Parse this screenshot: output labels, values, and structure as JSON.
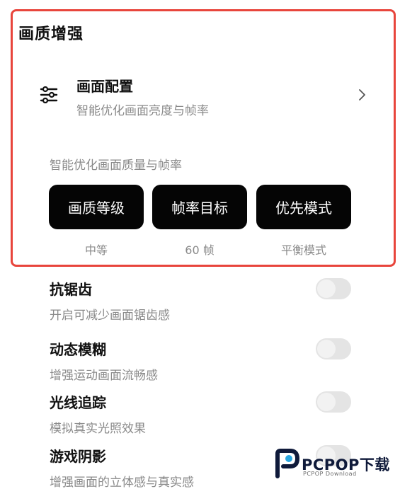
{
  "section": {
    "title": "画质增强"
  },
  "config": {
    "icon": "sliders-icon",
    "title": "画面配置",
    "subtitle": "智能优化画面亮度与帧率",
    "chevron": "chevron-right-icon"
  },
  "hint": "智能优化画面质量与帧率",
  "buttons": [
    {
      "label": "画质等级",
      "value": "中等"
    },
    {
      "label": "帧率目标",
      "value": "60 帧"
    },
    {
      "label": "优先模式",
      "value": "平衡模式"
    }
  ],
  "settings": [
    {
      "label": "抗锯齿",
      "desc": "开启可减少画面锯齿感",
      "enabled": false
    },
    {
      "label": "动态模糊",
      "desc": "增强运动画面流畅感",
      "enabled": false
    },
    {
      "label": "光线追踪",
      "desc": "模拟真实光照效果",
      "enabled": false
    },
    {
      "label": "游戏阴影",
      "desc": "增强画面的立体感与真实感",
      "enabled": false
    }
  ],
  "watermark": {
    "brand": "PCPOP下载",
    "sub": "PCPOP Download"
  },
  "colors": {
    "highlight": "#e8453c",
    "button_bg": "#050505",
    "toggle_off": "#e4e4e4"
  }
}
